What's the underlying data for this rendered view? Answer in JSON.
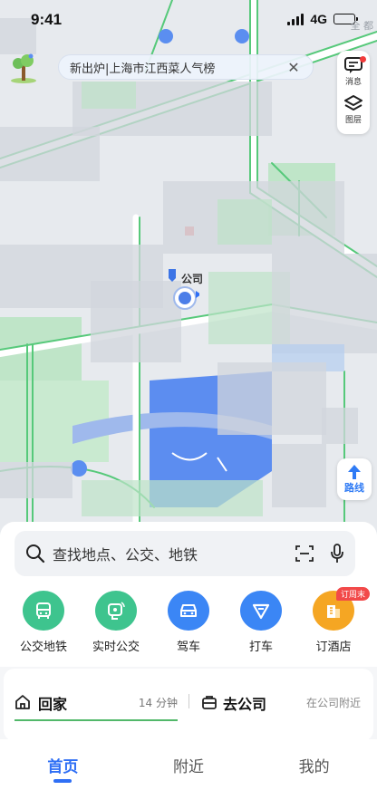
{
  "status_bar": {
    "time": "9:41",
    "network": "4G",
    "corner_text": "全 都"
  },
  "promo": {
    "text": "新出炉|上海市江西菜人气榜",
    "close_icon": "close-icon"
  },
  "side_panel": {
    "messages_label": "消息",
    "layers_label": "图层"
  },
  "map": {
    "marker_label": "公司",
    "route_label": "路线"
  },
  "search": {
    "placeholder": "查找地点、公交、地铁"
  },
  "quick_actions": [
    {
      "label": "公交地铁",
      "icon": "bus-icon",
      "color": "#3ec48e"
    },
    {
      "label": "实时公交",
      "icon": "realtime-bus-icon",
      "color": "#3ec48e"
    },
    {
      "label": "驾车",
      "icon": "car-icon",
      "color": "#3b86f5"
    },
    {
      "label": "打车",
      "icon": "taxi-icon",
      "color": "#3b86f5"
    },
    {
      "label": "订酒店",
      "icon": "hotel-icon",
      "color": "#f5a623",
      "badge": "订周末"
    }
  ],
  "shortcuts": {
    "home": {
      "label": "回家",
      "time": "14 分钟"
    },
    "work": {
      "label": "去公司",
      "sub": "在公司附近"
    }
  },
  "tabs": [
    {
      "label": "首页",
      "active": true
    },
    {
      "label": "附近",
      "active": false
    },
    {
      "label": "我的",
      "active": false
    }
  ],
  "colors": {
    "accent": "#2f6ff5",
    "green": "#52b86a"
  }
}
